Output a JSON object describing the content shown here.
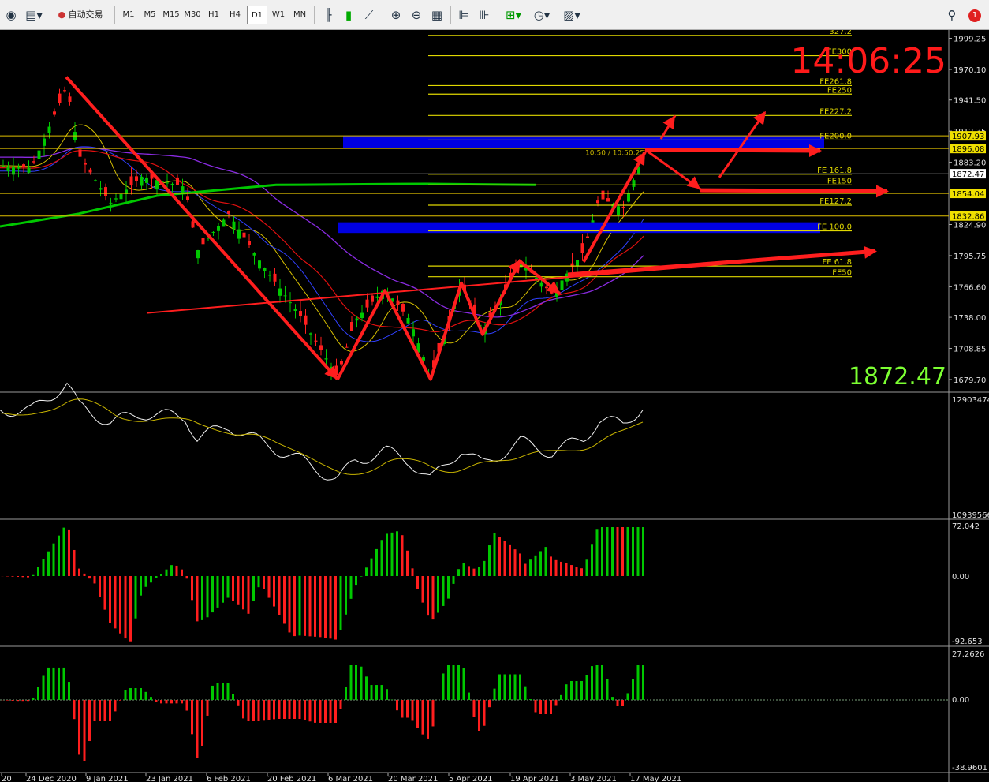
{
  "toolbar": {
    "autotrade_label": "自动交易",
    "timeframes": [
      "M1",
      "M5",
      "M15",
      "M30",
      "H1",
      "H4",
      "D1",
      "W1",
      "MN"
    ],
    "active_timeframe": "D1",
    "icons": [
      "globe-icon",
      "new-chart-icon",
      "autotrade-icon",
      "bar-chart-icon",
      "candlestick-icon",
      "line-chart-icon",
      "zoom-in-icon",
      "zoom-out-icon",
      "tile-windows-icon",
      "chart-shift-icon",
      "autoscroll-icon",
      "add-indicator-icon",
      "periods-icon",
      "templates-icon",
      "search-icon",
      "notification-icon"
    ],
    "notification_count": "1"
  },
  "clock": "14:06:25",
  "current_price_big": "1872.47",
  "price_axis": {
    "ticks": [
      "1999.25",
      "1970.10",
      "1941.50",
      "1912.35",
      "1883.20",
      "1824.90",
      "1795.75",
      "1766.60",
      "1738.00",
      "1708.85",
      "1679.70"
    ],
    "highlighted": [
      {
        "value": "1907.93",
        "color": "#f0e000"
      },
      {
        "value": "1896.08",
        "color": "#f0e000"
      },
      {
        "value": "1872.47",
        "color": "#ffffff"
      },
      {
        "value": "1854.04",
        "color": "#f0e000"
      },
      {
        "value": "1832.86",
        "color": "#f0e000"
      }
    ]
  },
  "fib_levels": [
    {
      "label": "327.2",
      "price": 2002.0
    },
    {
      "label": "FE300",
      "price": 1983.0
    },
    {
      "label": "FE261.8",
      "price": 1955.0
    },
    {
      "label": "FE250",
      "price": 1947.0
    },
    {
      "label": "FE227.2",
      "price": 1927.0
    },
    {
      "label": "FE200.0",
      "price": 1904.0
    },
    {
      "label": "FE 161.8",
      "price": 1872.0
    },
    {
      "label": "FE150",
      "price": 1862.0
    },
    {
      "label": "FE127.2",
      "price": 1843.0
    },
    {
      "label": "FE 100.0",
      "price": 1819.0
    },
    {
      "label": "FE 61.8",
      "price": 1786.0
    },
    {
      "label": "FE50",
      "price": 1776.0
    }
  ],
  "chart_text": "10:50 / 10:50:25",
  "osc1": {
    "top": "12903474",
    "bottom": "10939566"
  },
  "macd": {
    "top": "72.042",
    "zero": "0.00",
    "bottom": "-92.653"
  },
  "osma": {
    "top": "27.2626",
    "zero": "0.00",
    "bottom": "-38.9601"
  },
  "dates": [
    "20",
    "24 Dec 2020",
    "9 Jan 2021",
    "23 Jan 2021",
    "6 Feb 2021",
    "20 Feb 2021",
    "6 Mar 2021",
    "20 Mar 2021",
    "5 Apr 2021",
    "19 Apr 2021",
    "3 May 2021",
    "17 May 2021"
  ],
  "colors": {
    "up": "#00c800",
    "down": "#ff1e1e",
    "fib": "#e0d800",
    "zone": "#0000e0",
    "arrow": "#ff1e1e",
    "ma_green": "#00c800",
    "ma_purple": "#8a2be2"
  }
}
